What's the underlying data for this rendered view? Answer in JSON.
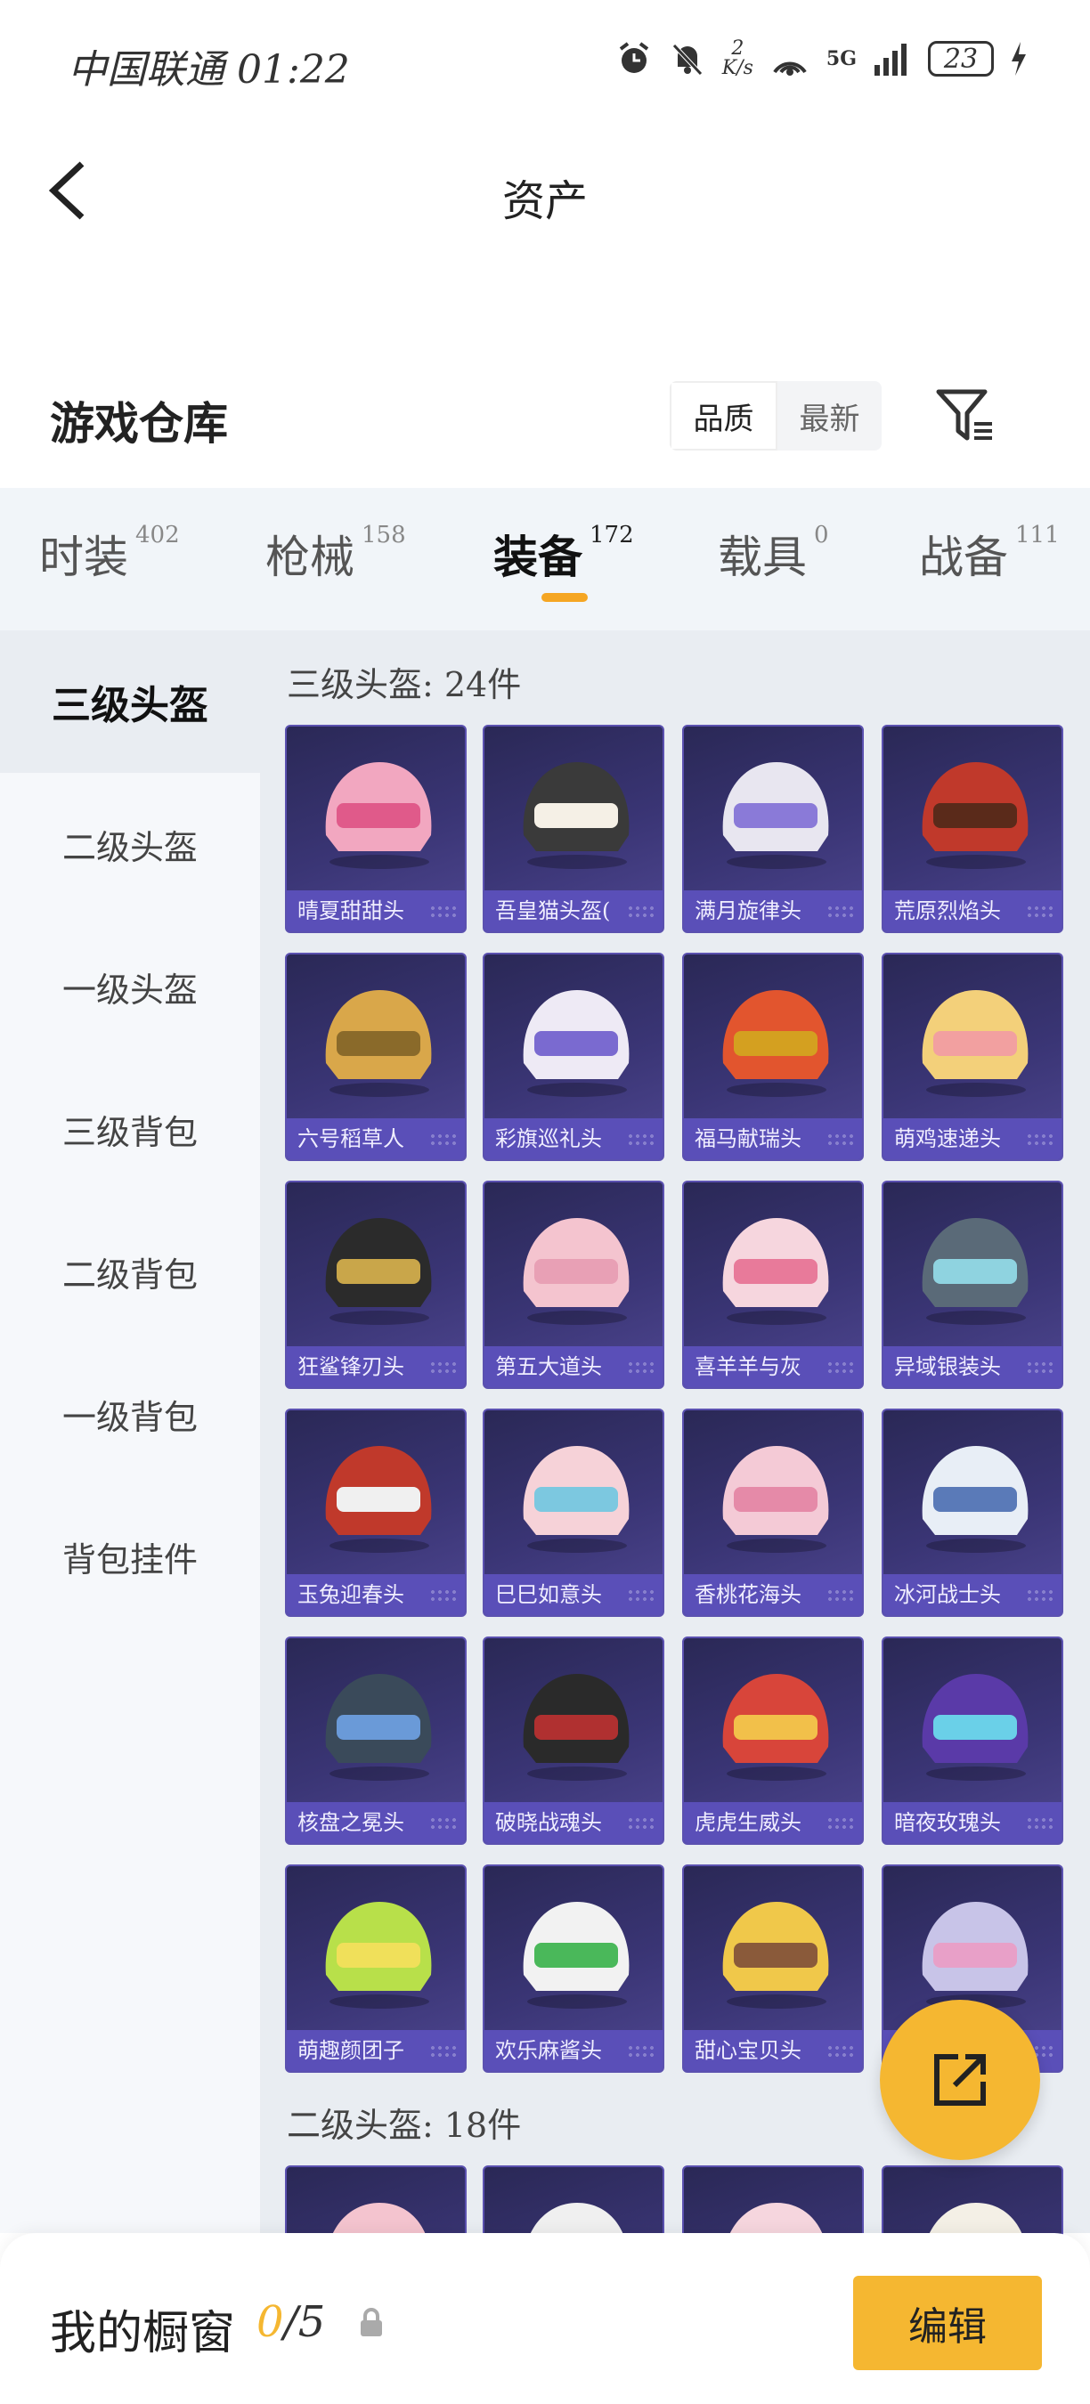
{
  "status_bar": {
    "carrier": "中国联通",
    "time": "01:22",
    "net_speed_value": "2",
    "net_speed_unit": "K/s",
    "signal": "5G",
    "battery": "23"
  },
  "header": {
    "title": "资产"
  },
  "warehouse": {
    "title": "游戏仓库",
    "sort_options": [
      "品质",
      "最新"
    ],
    "active_sort": "品质"
  },
  "tabs": [
    {
      "label": "时装",
      "count": "402"
    },
    {
      "label": "枪械",
      "count": "158"
    },
    {
      "label": "装备",
      "count": "172"
    },
    {
      "label": "载具",
      "count": "0"
    },
    {
      "label": "战备",
      "count": "111"
    }
  ],
  "active_tab": "装备",
  "sidebar": [
    {
      "label": "三级头盔"
    },
    {
      "label": "二级头盔"
    },
    {
      "label": "一级头盔"
    },
    {
      "label": "三级背包"
    },
    {
      "label": "二级背包"
    },
    {
      "label": "一级背包"
    },
    {
      "label": "背包挂件"
    }
  ],
  "sections": [
    {
      "label": "三级头盔: 24件"
    },
    {
      "label": "二级头盔: 18件"
    }
  ],
  "items": [
    {
      "name": "晴夏甜甜头",
      "color": "#f2a7c0",
      "accent": "#e05a8a"
    },
    {
      "name": "吾皇猫头盔(",
      "color": "#3a3a3a",
      "accent": "#f5f0e6"
    },
    {
      "name": "满月旋律头",
      "color": "#e8e6f0",
      "accent": "#8a7ad8"
    },
    {
      "name": "荒原烈焰头",
      "color": "#c0392b",
      "accent": "#5a2a1a"
    },
    {
      "name": "六号稻草人",
      "color": "#d9a74a",
      "accent": "#8a6a2a"
    },
    {
      "name": "彩旗巡礼头",
      "color": "#eeeaf5",
      "accent": "#7a6ad0"
    },
    {
      "name": "福马献瑞头",
      "color": "#e2552e",
      "accent": "#d4a020"
    },
    {
      "name": "萌鸡速递头",
      "color": "#f3d07a",
      "accent": "#f2a0a0"
    },
    {
      "name": "狂鲨锋刃头",
      "color": "#2b2b2b",
      "accent": "#c9a64a"
    },
    {
      "name": "第五大道头",
      "color": "#f4c4cf",
      "accent": "#e8a0b5"
    },
    {
      "name": "喜羊羊与灰",
      "color": "#f6d6de",
      "accent": "#e87a9a"
    },
    {
      "name": "异域银装头",
      "color": "#5a6a78",
      "accent": "#8fd3e0"
    },
    {
      "name": "玉兔迎春头",
      "color": "#c0392b",
      "accent": "#f0f0f0"
    },
    {
      "name": "巳巳如意头",
      "color": "#f6d2d8",
      "accent": "#7cc8e0"
    },
    {
      "name": "香桃花海头",
      "color": "#f4cad6",
      "accent": "#e58aa8"
    },
    {
      "name": "冰河战士头",
      "color": "#e8eef6",
      "accent": "#5a7ab8"
    },
    {
      "name": "核盘之冕头",
      "color": "#3a4a5a",
      "accent": "#6a9ad8"
    },
    {
      "name": "破晓战魂头",
      "color": "#2a2a2a",
      "accent": "#b03030"
    },
    {
      "name": "虎虎生威头",
      "color": "#d8453a",
      "accent": "#f2c04a"
    },
    {
      "name": "暗夜玫瑰头",
      "color": "#5a3aa8",
      "accent": "#6ad0e8"
    },
    {
      "name": "萌趣颜团子",
      "color": "#b8e04a",
      "accent": "#f0e05a"
    },
    {
      "name": "欢乐麻酱头",
      "color": "#f2f2f2",
      "accent": "#4ab85a"
    },
    {
      "name": "甜心宝贝头",
      "color": "#f0c84a",
      "accent": "#8a5a3a"
    },
    {
      "name": "",
      "color": "#c8c4e8",
      "accent": "#e8a0c8"
    },
    {
      "name": "",
      "color": "#f4c4cf",
      "accent": "#e8a0b5"
    },
    {
      "name": "",
      "color": "#f0f0f0",
      "accent": "#d0d0d0"
    },
    {
      "name": "",
      "color": "#f6d6de",
      "accent": "#e87a9a"
    },
    {
      "name": "",
      "color": "#f4f0e6",
      "accent": "#e0d0a0"
    }
  ],
  "bottom": {
    "showcase_label": "我的橱窗",
    "showcase_current": "0",
    "showcase_total": "/5",
    "edit_label": "编辑"
  },
  "colors": {
    "accent": "#f5b731",
    "card_bg": "#3a3575",
    "caption_bg": "#5a4fb8"
  }
}
